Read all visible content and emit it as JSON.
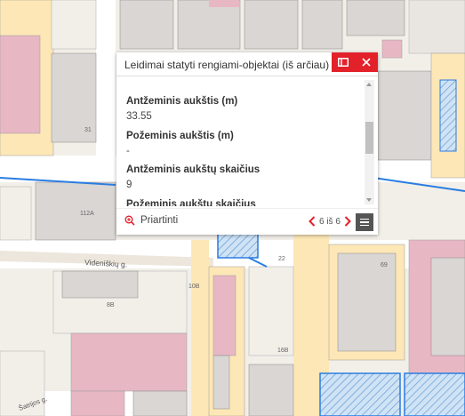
{
  "popup": {
    "title": "Leidimai statyti rengiami-objektai (iš arčiau)",
    "fields": [
      {
        "label": "Antžeminis aukštis (m)",
        "value": "33.55"
      },
      {
        "label": "Požeminis aukštis (m)",
        "value": "-"
      },
      {
        "label": "Antžeminis aukštų skaičius",
        "value": "9"
      },
      {
        "label": "Požeminis aukštų skaičius",
        "value": ""
      }
    ],
    "zoom_label": "Priartinti",
    "pager_text": "6 iš 6"
  },
  "map": {
    "street_label": "Videniškių g.",
    "street_label_2": "Šatrijos g.",
    "house_numbers": [
      "112A",
      "10B",
      "22",
      "8B",
      "16B",
      "31",
      "69"
    ]
  },
  "colors": {
    "accent_red": "#e3212b",
    "building_pink": "#e8b7c4",
    "road_yellow": "#fde7b6",
    "building_gray": "#d9d6d3",
    "parcel_blue": "#2a7de1"
  }
}
